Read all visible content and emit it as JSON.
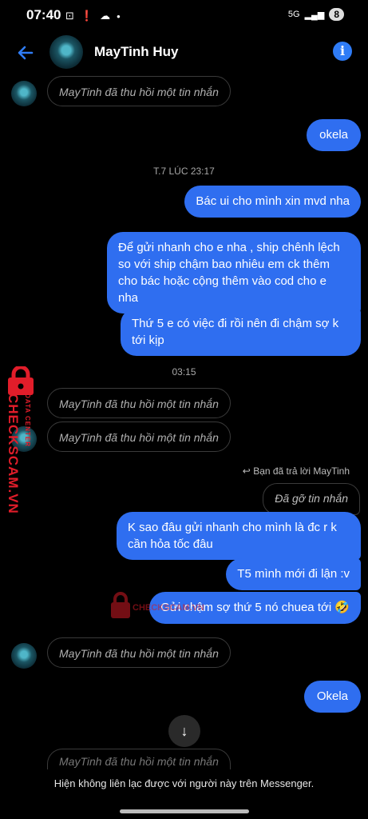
{
  "status_bar": {
    "time": "07:40",
    "network": "5G",
    "battery": "8"
  },
  "header": {
    "contact_name": "MayTinh Huy"
  },
  "messages": {
    "recalled_1": "MayTinh đã thu hồi một tin nhắn",
    "out_okela": "okela",
    "timestamp_1": "T.7 LÚC 23:17",
    "out_bac_ui": "Bác ui cho mình xin mvd nha",
    "out_de_gui": "Để gửi nhanh cho e nha , ship chênh lệch so với ship chậm bao nhiêu em ck thêm cho bác hoặc cộng thêm vào cod cho e nha",
    "out_thu5": "Thứ 5 e có việc đi rồi nên đi chậm sợ k tới kịp",
    "timestamp_2": "03:15",
    "recalled_2": "MayTinh đã thu hồi một tin nhắn",
    "recalled_3": "MayTinh đã thu hồi một tin nhắn",
    "reply_label": "Bạn đã trả lời MayTinh",
    "reply_quote": "Đã gỡ tin nhắn",
    "out_k_sao": "K sao đâu gửi nhanh cho mình là đc r k cần hỏa tốc đâu",
    "out_t5": "T5 mình mới đi lận :v",
    "out_gui_cham": "Gửi chậm sợ thứ 5 nó chuea tới 🤣",
    "recalled_4": "MayTinh đã thu hồi một tin nhắn",
    "out_okela2": "Okela",
    "recalled_5_partial": "MayTinh đã thu hồi một tin nhắn"
  },
  "footer": {
    "notice": "Hiện không liên lạc được với người này trên Messenger."
  },
  "watermark": {
    "brand": "CHECKSCAM.VN",
    "sub": "DATA CENTER",
    "mid_text": "CHECKSCAM.VN"
  },
  "colors": {
    "outgoing_bubble": "#2f6ef0",
    "accent": "#2f7cf6",
    "watermark": "#e11d2a"
  }
}
